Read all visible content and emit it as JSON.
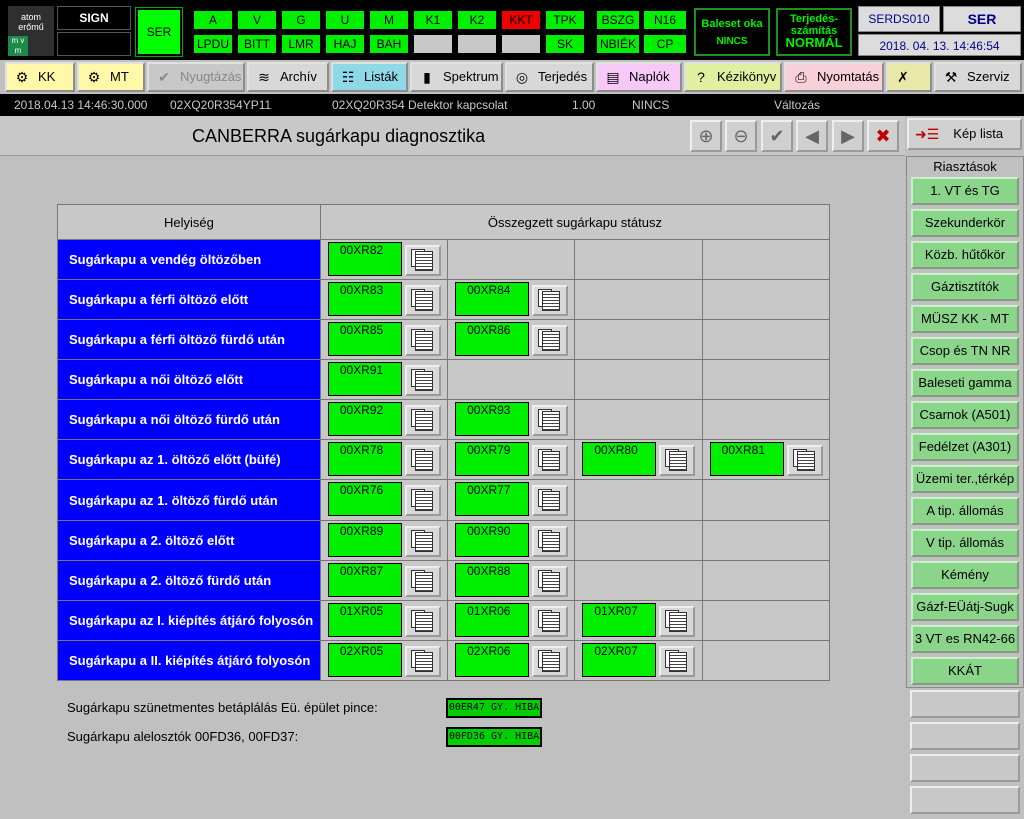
{
  "header": {
    "logo": "atom erőmű",
    "logo_mark": "m v m",
    "sign": "SIGN",
    "ser": "SER",
    "row1": [
      "A",
      "V",
      "G",
      "U",
      "M",
      "K1",
      "K2",
      "KKT",
      "TPK"
    ],
    "row2": [
      "LPDU",
      "BITT",
      "LMR",
      "HAJ",
      "BAH",
      "",
      "",
      "",
      "SK"
    ],
    "grp2_row1": [
      "BSZG",
      "N16"
    ],
    "grp2_row2": [
      "NBIÉK",
      "CP"
    ],
    "baleset": [
      "Baleset oka",
      "NINCS"
    ],
    "terjedes": [
      "Terjedés-",
      "számítás",
      "NORMÁL"
    ],
    "serds": "SERDS010",
    "ser_right": "SER",
    "datetime": "2018. 04. 13.  14:46:54"
  },
  "toolbar": {
    "items": [
      {
        "label": "KK",
        "icon": "kk-icon"
      },
      {
        "label": "MT",
        "icon": "mt-icon"
      },
      {
        "label": "Nyugtázás",
        "icon": "check-icon"
      },
      {
        "label": "Archív",
        "icon": "archive-icon"
      },
      {
        "label": "Listák",
        "icon": "list-icon"
      },
      {
        "label": "Spektrum",
        "icon": "spectrum-icon"
      },
      {
        "label": "Terjedés",
        "icon": "radar-icon"
      },
      {
        "label": "Naplók",
        "icon": "book-icon"
      },
      {
        "label": "Kézikönyv",
        "icon": "help-icon"
      },
      {
        "label": "Nyomtatás",
        "icon": "printer-icon"
      },
      {
        "label": "",
        "icon": "tools-icon"
      },
      {
        "label": "Szerviz",
        "icon": "wrench-icon"
      }
    ]
  },
  "message": {
    "time": "2018.04.13 14:46:30.000",
    "id": "02XQ20R354YP11",
    "text": "02XQ20R354 Detektor kapcsolat",
    "value": "1.00",
    "status": "NINCS",
    "change": "Változás"
  },
  "page": {
    "title": "CANBERRA sugárkapu diagnosztika",
    "kep_lista": "Kép lista"
  },
  "alarms": {
    "heading": "Riasztások",
    "items": [
      "1. VT és TG",
      "Szekunderkör",
      "Közb. hűtőkör",
      "Gáztisztítók",
      "MÜSZ  KK - MT",
      "Csop és TN NR",
      "Baleseti gamma",
      "Csarnok (A501)",
      "Fedélzet (A301)",
      "Üzemi ter.,térkép",
      "A tip. állomás",
      "V tip. állomás",
      "Kémény",
      "Gázf-EÜátj-Sugk",
      "3 VT es RN42-66",
      "KKÁT"
    ]
  },
  "table": {
    "col_location": "Helyiség",
    "col_status": "Összegzett sugárkapu státusz",
    "rows": [
      {
        "location": "Sugárkapu a vendég öltözőben",
        "gates": [
          "00XR82"
        ]
      },
      {
        "location": "Sugárkapu a férfi öltöző előtt",
        "gates": [
          "00XR83",
          "00XR84"
        ]
      },
      {
        "location": "Sugárkapu a férfi öltöző fürdő után",
        "gates": [
          "00XR85",
          "00XR86"
        ]
      },
      {
        "location": "Sugárkapu a női öltöző előtt",
        "gates": [
          "00XR91"
        ]
      },
      {
        "location": "Sugárkapu a női öltöző fürdő után",
        "gates": [
          "00XR92",
          "00XR93"
        ]
      },
      {
        "location": "Sugárkapu az 1. öltöző előtt (büfé)",
        "gates": [
          "00XR78",
          "00XR79",
          "00XR80",
          "00XR81"
        ]
      },
      {
        "location": "Sugárkapu az 1. öltöző fürdő után",
        "gates": [
          "00XR76",
          "00XR77"
        ]
      },
      {
        "location": "Sugárkapu a 2. öltöző előtt",
        "gates": [
          "00XR89",
          "00XR90"
        ]
      },
      {
        "location": "Sugárkapu a 2. öltöző fürdő után",
        "gates": [
          "00XR87",
          "00XR88"
        ]
      },
      {
        "location": "Sugárkapu az I. kiépítés átjáró folyosón",
        "gates": [
          "01XR05",
          "01XR06",
          "01XR07"
        ]
      },
      {
        "location": "Sugárkapu a II. kiépítés átjáró folyosón",
        "gates": [
          "02XR05",
          "02XR06",
          "02XR07"
        ]
      }
    ]
  },
  "bottom": {
    "line1_label": "Sugárkapu szünetmentes betáplálás Eü. épület pince:",
    "line1_status": "00ER47 GY. HIBA",
    "line2_label": "Sugárkapu alelosztók 00FD36, 00FD37:",
    "line2_status": "00FD36 GY. HIBA"
  },
  "colors": {
    "ok": "#00f000",
    "alarm": "#f00000",
    "location_bg": "#0000ff",
    "alarm_button": "#8ad58a"
  }
}
